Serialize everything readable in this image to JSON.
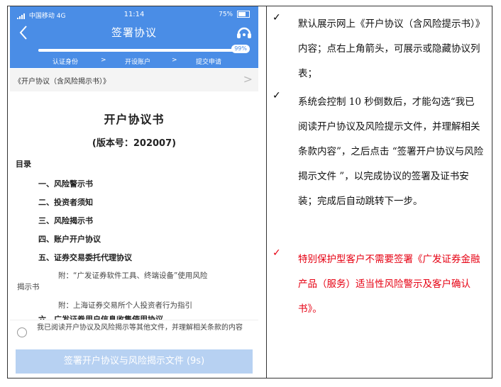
{
  "status_bar": {
    "carrier": "中国移动",
    "network": "4G",
    "time": "11:14",
    "battery": "75%"
  },
  "header": {
    "back_icon": "chevron-left-icon",
    "title": "签署协议",
    "service_icon": "headset-icon"
  },
  "progress": {
    "percent_label": "99%",
    "value": 0.99,
    "steps": [
      "认证身份",
      ">",
      "开设账户",
      ">",
      "提交申请"
    ]
  },
  "contract_selector": {
    "label": "《开户协议（含风险揭示书）》",
    "chevron": ">"
  },
  "document": {
    "title": "开户协议书",
    "version": "(版本号：202007)",
    "toc_heading": "目录",
    "items": [
      "一、风险警示书",
      "二、投资者须知",
      "三、风险揭示书",
      "四、账户开户协议",
      "五、证券交易委托代理协议"
    ],
    "subitems": [
      "附：“广发证券软件工具、终端设备”使用风险",
      "揭示书",
      "附：上海证券交易所个人投资者行为指引"
    ],
    "cut_item": "六、广发证券用户信息收集使用协议"
  },
  "agreement": {
    "checkbox_text": "我已阅读开户协议及风险揭示等其他文件，并理解相关条款的内容"
  },
  "sign_button": {
    "label": "签署开户协议与风险揭示文件 (9s)"
  },
  "notes": [
    {
      "mark": "✓",
      "text": "默认展示网上《开户协议（含风险提示书）》内容；点右上角箭头，可展示或隐藏协议列表；",
      "color": "#111111"
    },
    {
      "mark": "✓",
      "text": "系统会控制 10 秒倒数后，才能勾选“我已阅读开户协议及风险提示文件，并理解相关条款内容”，之后点击 “签署开户协议与风险揭示文件 ”，以完成协议的签署及证书安装；完成后自动跳转下一步。",
      "color": "#111111"
    },
    {
      "mark": "✓",
      "text": "特别保护型客户不需要签署《广发证券金融产品（服务）适当性风险警示及客户确认书》。",
      "color": "#e60012"
    }
  ]
}
